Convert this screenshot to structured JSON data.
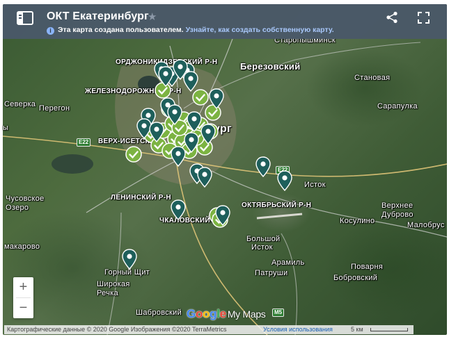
{
  "header": {
    "title": "ОКТ Екатеринбург",
    "info_text": "Эта карта создана пользователем.",
    "learn_link": "Узнайте, как создать собственную карту."
  },
  "places": {
    "staropyshminsk": "Старопышминск",
    "ordzhonikidze": "ОРДЖОНИКИДЗЕВСКИЙ Р-Н",
    "berezovsky": "Березовский",
    "stanovaya": "Становая",
    "zheleznodorozhny": "ЖЕЛЕЗНОДОРОЖНЫЙ Р-Н",
    "severka": "Северка",
    "peregon": "Перегон",
    "sarapulka": "Сарапулка",
    "yekaterinburg_fragment": "бург",
    "verkh_isetsky": "ВЕРХ-ИСЕТСКИЙ",
    "istok": "Исток",
    "leninsky": "ЛЕНИНСКИЙ Р-Н",
    "usovskoe": "Чусовское",
    "ozero": "Озеро",
    "oktyabrsky": "ОКТЯБРЬСКИЙ Р-Н",
    "verkhnee_dubrovo_1": "Верхнее",
    "verkhnee_dubrovo_2": "Дуброво",
    "koltsovo": "Косулино",
    "chkalovsky": "ЧКАЛОВСКИЙ Р-Н",
    "malobrus": "Малобрус",
    "bolshoy_istok_1": "Большой",
    "bolshoy_istok_2": "Исток",
    "makarovo": "макарово",
    "aramil": "Арамиль",
    "gorny_shchit": "Горный Щит",
    "povarnya": "Поварня",
    "patrushi": "Патруши",
    "bobrovsky": "Бобровский",
    "shirokaya_1": "Широкая",
    "shirokaya_2": "Речка",
    "shabrovsky": "Шабровский",
    "left_fragment": "ы"
  },
  "road_shields": {
    "e22_west": "E22",
    "e22_east": "E22",
    "m5": "M5"
  },
  "zoom": {
    "in": "+",
    "out": "−"
  },
  "logo": {
    "google": "Google",
    "mymaps": "My Maps"
  },
  "attribution": {
    "text": "Картографические данные © 2020 Google Изображения ©2020 TerraMetrics",
    "terms": "Условия использования",
    "scale": "5 км"
  },
  "colors": {
    "header_bg": "#4a5868",
    "marker_pin": "#1e5f5b",
    "check_marker": "#7cb342"
  },
  "markers": {
    "pin_count": 20,
    "check_count": 30
  }
}
